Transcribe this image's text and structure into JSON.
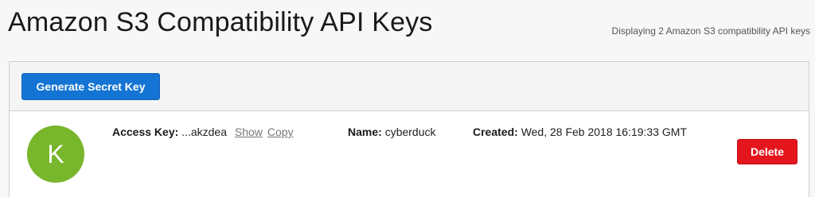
{
  "page": {
    "title": "Amazon S3 Compatibility API Keys",
    "display_count": "Displaying 2 Amazon S3 compatibility API keys"
  },
  "toolbar": {
    "generate_label": "Generate Secret Key"
  },
  "keys": [
    {
      "avatar_letter": "K",
      "avatar_color": "#78b62c",
      "access_key_label": "Access Key:",
      "access_key_value": "...akzdea",
      "show_label": "Show",
      "copy_label": "Copy",
      "name_label": "Name:",
      "name_value": "cyberduck",
      "created_label": "Created:",
      "created_value": "Wed, 28 Feb 2018 16:19:33 GMT",
      "delete_label": "Delete"
    }
  ],
  "colors": {
    "primary": "#1474d4",
    "danger": "#e4151d",
    "avatar": "#78b62c"
  }
}
